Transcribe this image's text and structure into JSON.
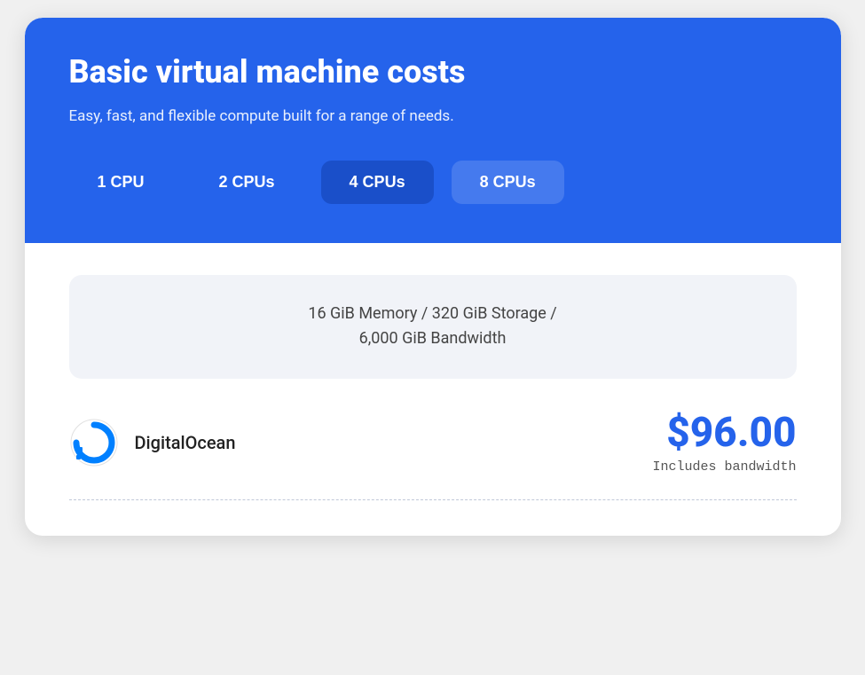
{
  "header": {
    "title": "Basic virtual machine costs",
    "subtitle": "Easy, fast, and flexible compute built for a range of needs.",
    "background_color": "#2563EB"
  },
  "cpu_tabs": [
    {
      "label": "1 CPU",
      "state": "inactive"
    },
    {
      "label": "2 CPUs",
      "state": "inactive"
    },
    {
      "label": "4 CPUs",
      "state": "active"
    },
    {
      "label": "8 CPUs",
      "state": "secondary"
    }
  ],
  "specs": {
    "text_line1": "16 GiB Memory / 320 GiB Storage /",
    "text_line2": "6,000 GiB Bandwidth"
  },
  "provider": {
    "name": "DigitalOcean",
    "price": "$96.00",
    "price_note": "Includes bandwidth"
  }
}
